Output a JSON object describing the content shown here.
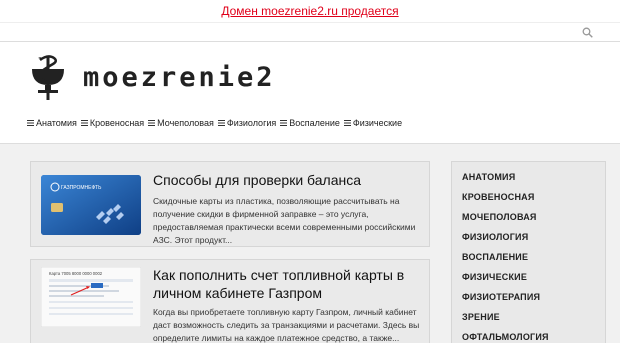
{
  "sale_banner": {
    "text": "Домен moezrenie2.ru продается"
  },
  "search": {
    "icon": "search-icon"
  },
  "site": {
    "title": "moezrenie2",
    "logo_icon": "caduceus-bowl-icon"
  },
  "nav": {
    "items": [
      {
        "label": "Анатомия"
      },
      {
        "label": "Кровеносная"
      },
      {
        "label": "Мочеполовая"
      },
      {
        "label": "Физиология"
      },
      {
        "label": "Воспаление"
      },
      {
        "label": "Физические"
      }
    ]
  },
  "articles": [
    {
      "title": "Способы для проверки баланса",
      "excerpt": "Скидочные карты из пластика, позволяющие рассчитывать на получение скидки в фирменной заправке – это услуга, предоставляемая практически всеми современными российскими АЗС. Этот продукт...",
      "thumb_label": "ГАЗПРОМНЕФТЬ"
    },
    {
      "title": "Как пополнить счет топливной карты в личном кабинете Газпром",
      "excerpt": "Когда вы приобретаете топливную карту Газпром, личный кабинет даст возможность следить за транзакциями и расчетами. Здесь вы определите лимиты на каждое платежное средство, а также...",
      "thumb_label": "Карта 7005 8000 0000 0002"
    }
  ],
  "sidebar": {
    "items": [
      {
        "label": "АНАТОМИЯ"
      },
      {
        "label": "КРОВЕНОСНАЯ"
      },
      {
        "label": "МОЧЕПОЛОВАЯ"
      },
      {
        "label": "ФИЗИОЛОГИЯ"
      },
      {
        "label": "ВОСПАЛЕНИЕ"
      },
      {
        "label": "ФИЗИЧЕСКИЕ"
      },
      {
        "label": "ФИЗИОТЕРАПИЯ"
      },
      {
        "label": "ЗРЕНИЕ"
      },
      {
        "label": "ОФТАЛЬМОЛОГИЯ"
      }
    ]
  },
  "colors": {
    "sale_link": "#e0001a",
    "background": "#f1f1f1",
    "card": "#eaeaea"
  }
}
